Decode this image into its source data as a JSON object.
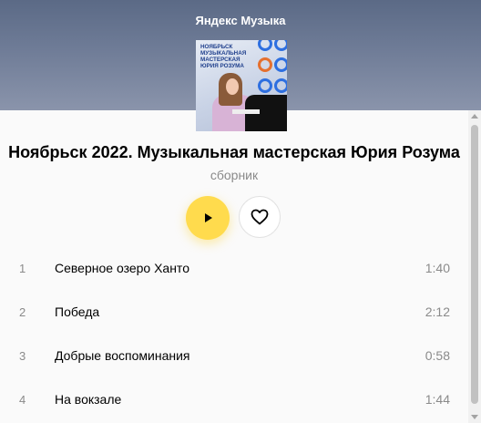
{
  "header": {
    "title": "Яндекс Музыка"
  },
  "cover": {
    "text": "НОЯБРЬСК\nМУЗЫКАЛЬНАЯ\nМАСТЕРСКАЯ\nЮРИЯ РОЗУМА",
    "ring_colors": [
      "#2e6fe0",
      "#e5702f"
    ]
  },
  "album": {
    "title": "Ноябрьск 2022. Музыкальная мастерская Юрия Розума",
    "subtitle": "сборник"
  },
  "controls": {
    "play_icon": "play-icon",
    "like_icon": "heart-icon",
    "accent_color": "#ffdb4d"
  },
  "tracks": [
    {
      "num": "1",
      "name": "Северное озеро Ханто",
      "duration": "1:40"
    },
    {
      "num": "2",
      "name": "Победа",
      "duration": "2:12"
    },
    {
      "num": "3",
      "name": "Добрые воспоминания",
      "duration": "0:58"
    },
    {
      "num": "4",
      "name": "На вокзале",
      "duration": "1:44"
    }
  ]
}
